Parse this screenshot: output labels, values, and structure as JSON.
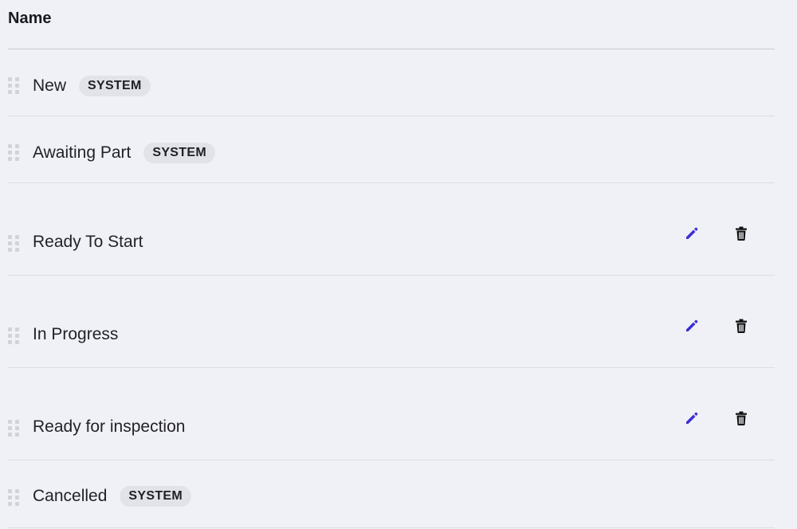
{
  "table": {
    "header": "Name",
    "rows": [
      {
        "label": "New",
        "badge": "SYSTEM"
      },
      {
        "label": "Awaiting Part",
        "badge": "SYSTEM"
      },
      {
        "label": "Ready To Start"
      },
      {
        "label": "In Progress"
      },
      {
        "label": "Ready for inspection"
      },
      {
        "label": "Cancelled",
        "badge": "SYSTEM"
      }
    ]
  },
  "colors": {
    "edit_icon": "#3b2fd6",
    "delete_icon": "#111111",
    "badge_bg": "#e2e3e8",
    "background": "#f0f1f6"
  },
  "icons": {
    "edit": "pencil-icon",
    "delete": "trash-icon",
    "drag": "drag-handle-icon"
  }
}
